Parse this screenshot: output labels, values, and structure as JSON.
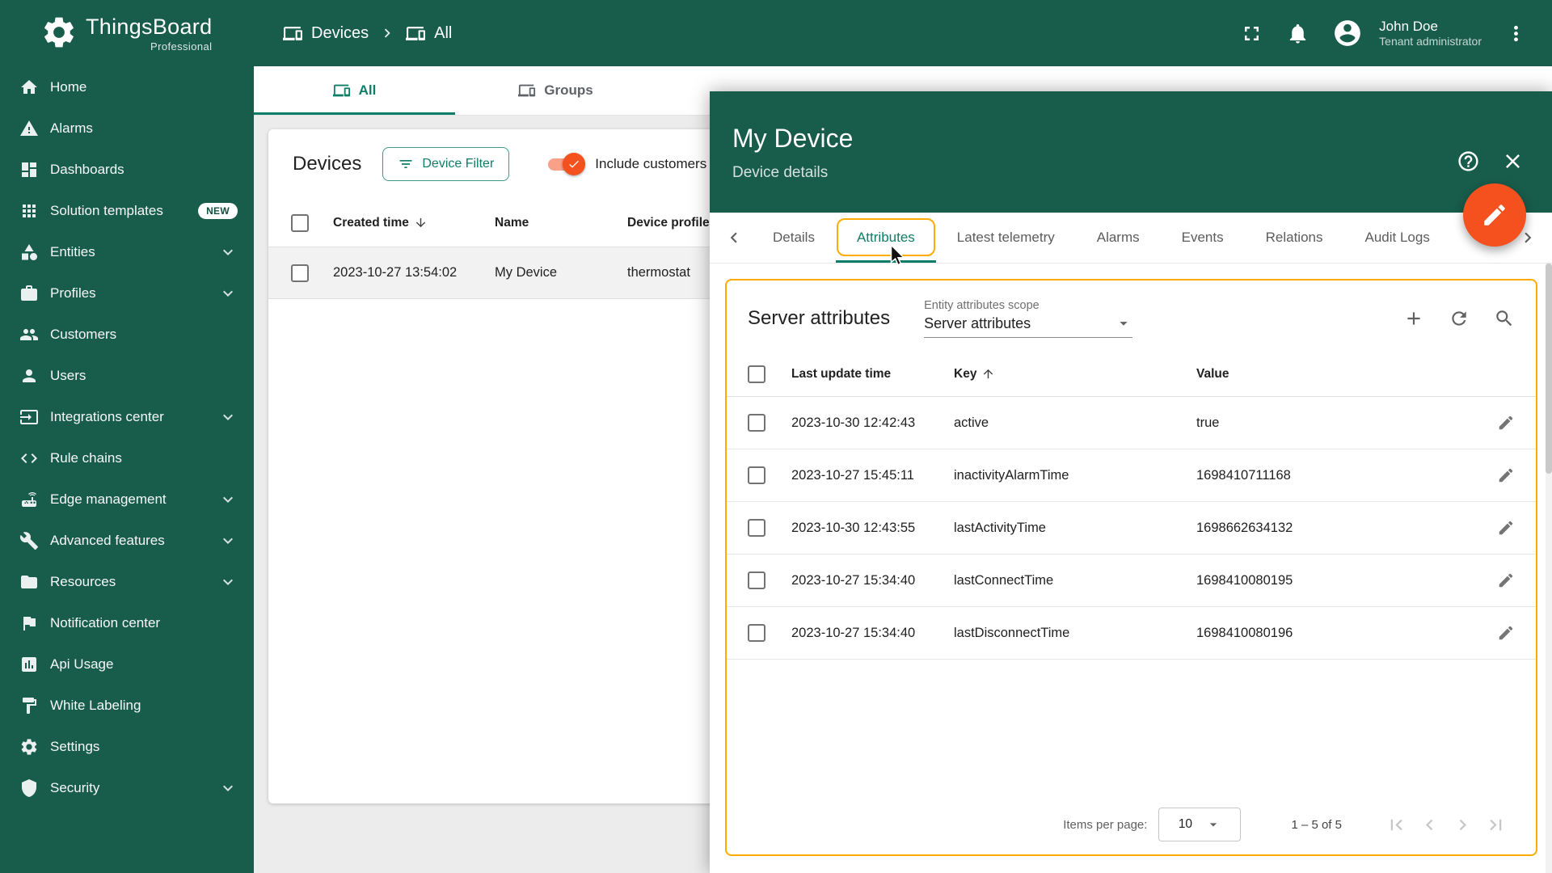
{
  "app": {
    "brand": "ThingsBoard",
    "brand_tagline": "Professional"
  },
  "sidebar": {
    "items": [
      {
        "label": "Home",
        "icon": "home-icon"
      },
      {
        "label": "Alarms",
        "icon": "alarms-icon"
      },
      {
        "label": "Dashboards",
        "icon": "dashboards-icon"
      },
      {
        "label": "Solution templates",
        "icon": "solution-templates-icon",
        "badge": "NEW"
      },
      {
        "label": "Entities",
        "icon": "entities-icon",
        "expandable": true
      },
      {
        "label": "Profiles",
        "icon": "profiles-icon",
        "expandable": true
      },
      {
        "label": "Customers",
        "icon": "customers-icon"
      },
      {
        "label": "Users",
        "icon": "users-icon"
      },
      {
        "label": "Integrations center",
        "icon": "integrations-icon",
        "expandable": true
      },
      {
        "label": "Rule chains",
        "icon": "rule-chains-icon"
      },
      {
        "label": "Edge management",
        "icon": "edge-management-icon",
        "expandable": true
      },
      {
        "label": "Advanced features",
        "icon": "advanced-features-icon",
        "expandable": true
      },
      {
        "label": "Resources",
        "icon": "resources-icon",
        "expandable": true
      },
      {
        "label": "Notification center",
        "icon": "notification-center-icon"
      },
      {
        "label": "Api Usage",
        "icon": "api-usage-icon"
      },
      {
        "label": "White Labeling",
        "icon": "white-labeling-icon"
      },
      {
        "label": "Settings",
        "icon": "settings-icon"
      },
      {
        "label": "Security",
        "icon": "security-icon",
        "expandable": true
      }
    ]
  },
  "header": {
    "breadcrumb": [
      "Devices",
      "All"
    ],
    "user": {
      "name": "John Doe",
      "role": "Tenant administrator"
    }
  },
  "main": {
    "tabs": [
      {
        "label": "All"
      },
      {
        "label": "Groups"
      }
    ],
    "devices_table": {
      "title": "Devices",
      "filter_button": "Device Filter",
      "include_toggle_label": "Include customers",
      "columns": [
        "Created time",
        "Name",
        "Device profile"
      ],
      "rows": [
        {
          "created_time": "2023-10-27 13:54:02",
          "name": "My Device",
          "device_profile": "thermostat"
        }
      ]
    }
  },
  "drawer": {
    "title": "My Device",
    "subtitle": "Device details",
    "tabs": [
      "Details",
      "Attributes",
      "Latest telemetry",
      "Alarms",
      "Events",
      "Relations",
      "Audit Logs"
    ],
    "active_tab": "Attributes",
    "attributes": {
      "heading": "Server attributes",
      "scope_label": "Entity attributes scope",
      "scope_value": "Server attributes",
      "columns": [
        "Last update time",
        "Key",
        "Value"
      ],
      "rows": [
        {
          "time": "2023-10-30 12:42:43",
          "key": "active",
          "value": "true"
        },
        {
          "time": "2023-10-27 15:45:11",
          "key": "inactivityAlarmTime",
          "value": "1698410711168"
        },
        {
          "time": "2023-10-30 12:43:55",
          "key": "lastActivityTime",
          "value": "1698662634132"
        },
        {
          "time": "2023-10-27 15:34:40",
          "key": "lastConnectTime",
          "value": "1698410080195"
        },
        {
          "time": "2023-10-27 15:34:40",
          "key": "lastDisconnectTime",
          "value": "1698410080196"
        }
      ],
      "paginator": {
        "items_per_page_label": "Items per page:",
        "items_per_page": "10",
        "range_label": "1 – 5 of 5"
      }
    }
  },
  "colors": {
    "primary_green": "#185c4b",
    "active_teal": "#0f7e68",
    "accent_orange": "#f4511e",
    "focus_ring_amber": "#ffab00"
  }
}
